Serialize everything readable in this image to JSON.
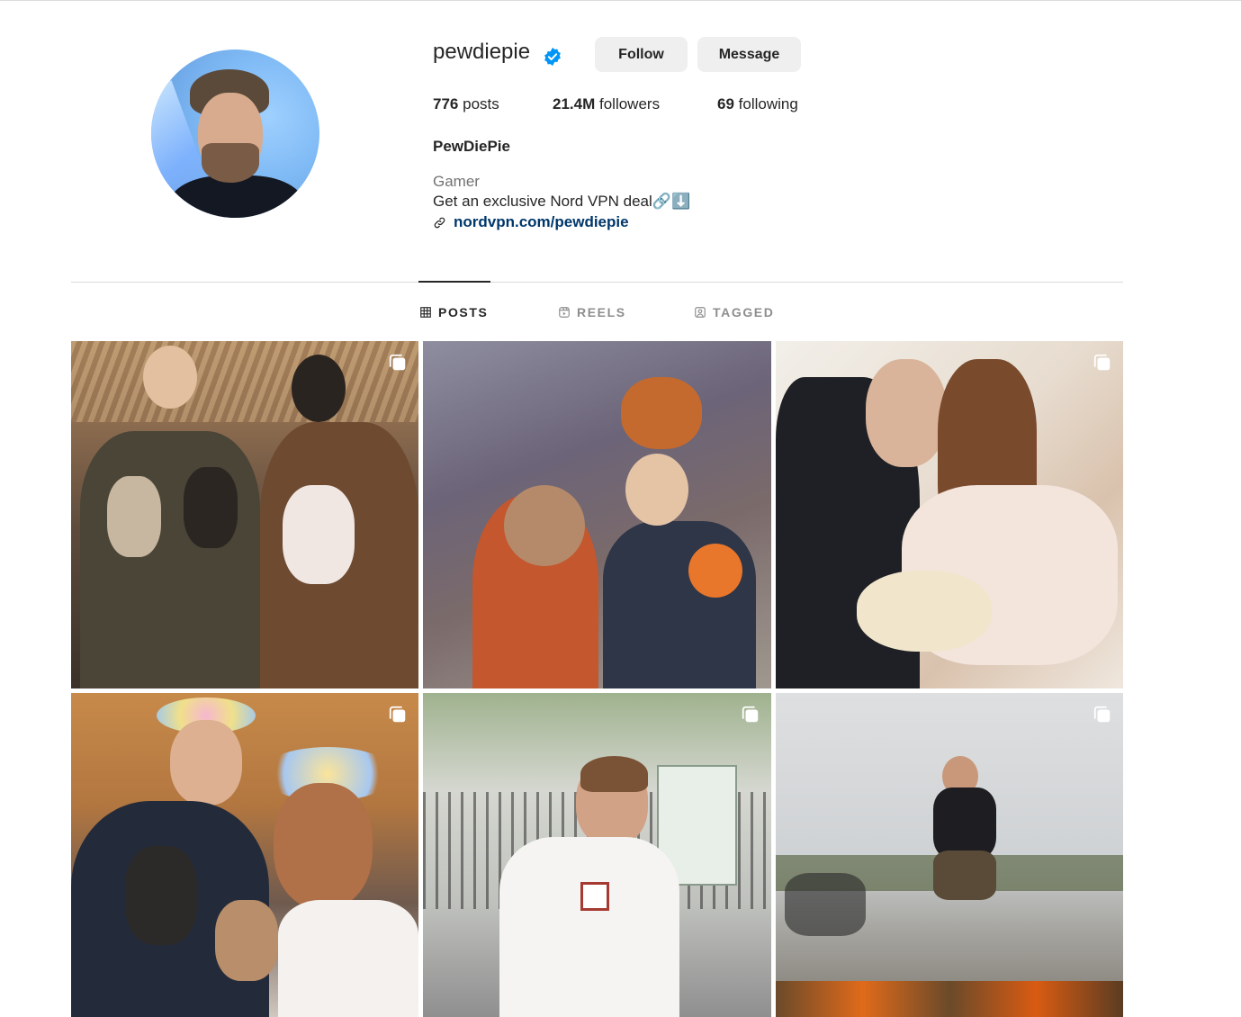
{
  "profile": {
    "username": "pewdiepie",
    "verified": true,
    "follow_label": "Follow",
    "message_label": "Message",
    "posts_count": "776",
    "posts_label": "posts",
    "followers_count": "21.4M",
    "followers_label": "followers",
    "following_count": "69",
    "following_label": "following",
    "full_name": "PewDiePie",
    "category": "Gamer",
    "bio": "Get an exclusive Nord VPN deal🔗⬇️",
    "link_text": "nordvpn.com/pewdiepie"
  },
  "tabs": [
    {
      "label": "POSTS",
      "active": true,
      "icon": "grid-icon"
    },
    {
      "label": "REELS",
      "active": false,
      "icon": "reels-icon"
    },
    {
      "label": "TAGGED",
      "active": false,
      "icon": "tagged-icon"
    }
  ],
  "posts": [
    {
      "multi": true
    },
    {
      "multi": false
    },
    {
      "multi": true
    },
    {
      "multi": true
    },
    {
      "multi": true
    },
    {
      "multi": true
    }
  ],
  "colors": {
    "verified_blue": "#0095f6",
    "link_blue": "#00376b",
    "button_bg": "#efefef"
  }
}
